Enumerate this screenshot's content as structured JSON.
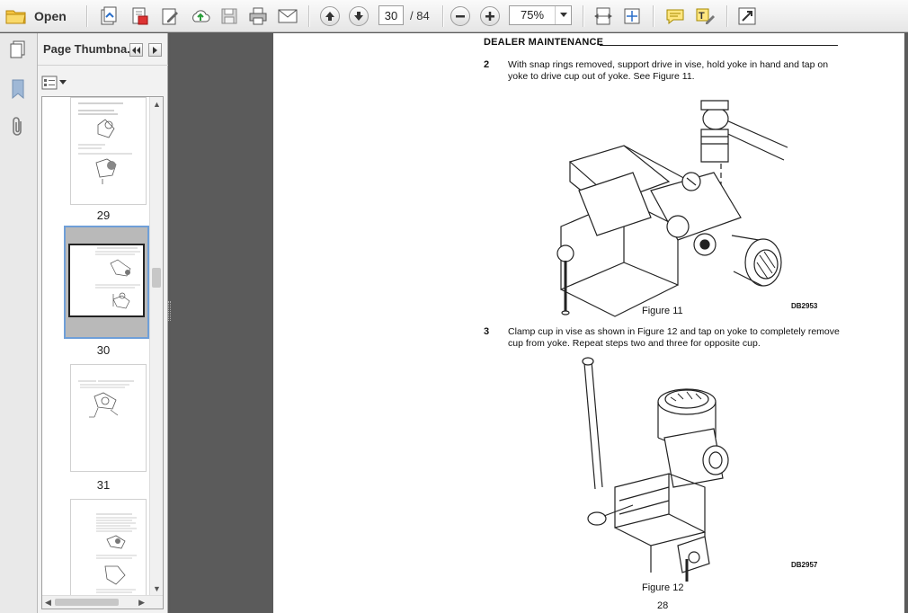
{
  "toolbar": {
    "open_label": "Open",
    "page_current": "30",
    "page_total": "/ 84",
    "zoom": "75%"
  },
  "panel": {
    "title": "Page Thumbna..."
  },
  "thumbnails": [
    {
      "label": "29"
    },
    {
      "label": "30"
    },
    {
      "label": "31"
    },
    {
      "label": ""
    }
  ],
  "document": {
    "header": "DEALER MAINTENANCE",
    "step2_num": "2",
    "step2_text": "With snap rings removed, support drive in vise, hold yoke in hand and tap on yoke to drive cup out of yoke. See Figure 11.",
    "fig11_caption": "Figure 11",
    "fig11_code": "DB2953",
    "step3_num": "3",
    "step3_text": "Clamp cup in vise as shown in Figure 12 and tap on yoke to completely remove cup from yoke. Repeat steps two and three for opposite cup.",
    "fig12_caption": "Figure 12",
    "fig12_code": "DB2957",
    "page_number": "28"
  }
}
